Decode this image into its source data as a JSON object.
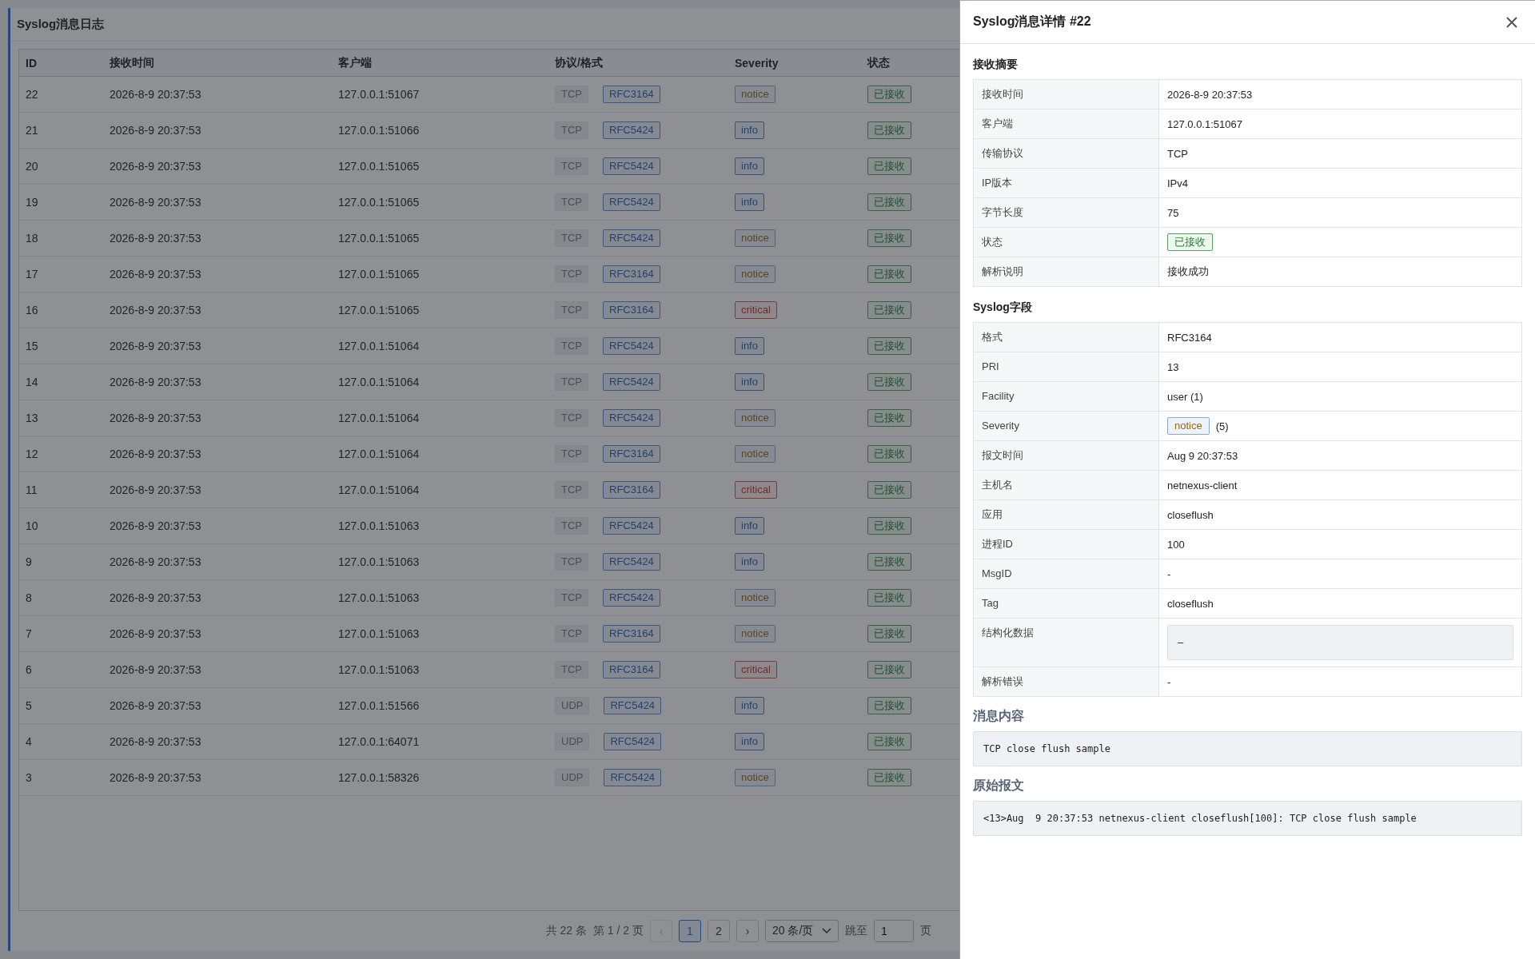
{
  "page": {
    "title": "Syslog消息日志"
  },
  "table": {
    "columns": [
      "ID",
      "接收时间",
      "客户端",
      "协议/格式",
      "Severity",
      "状态"
    ],
    "rows": [
      {
        "id": "22",
        "time": "2026-8-9 20:37:53",
        "client": "127.0.0.1:51067",
        "protocol": "TCP",
        "format": "RFC3164",
        "severity": {
          "label": "notice",
          "kind": "notice"
        },
        "status": "已接收"
      },
      {
        "id": "21",
        "time": "2026-8-9 20:37:53",
        "client": "127.0.0.1:51066",
        "protocol": "TCP",
        "format": "RFC5424",
        "severity": {
          "label": "info",
          "kind": "info"
        },
        "status": "已接收"
      },
      {
        "id": "20",
        "time": "2026-8-9 20:37:53",
        "client": "127.0.0.1:51065",
        "protocol": "TCP",
        "format": "RFC5424",
        "severity": {
          "label": "info",
          "kind": "info"
        },
        "status": "已接收"
      },
      {
        "id": "19",
        "time": "2026-8-9 20:37:53",
        "client": "127.0.0.1:51065",
        "protocol": "TCP",
        "format": "RFC5424",
        "severity": {
          "label": "info",
          "kind": "info"
        },
        "status": "已接收"
      },
      {
        "id": "18",
        "time": "2026-8-9 20:37:53",
        "client": "127.0.0.1:51065",
        "protocol": "TCP",
        "format": "RFC5424",
        "severity": {
          "label": "notice",
          "kind": "notice"
        },
        "status": "已接收"
      },
      {
        "id": "17",
        "time": "2026-8-9 20:37:53",
        "client": "127.0.0.1:51065",
        "protocol": "TCP",
        "format": "RFC3164",
        "severity": {
          "label": "notice",
          "kind": "notice"
        },
        "status": "已接收"
      },
      {
        "id": "16",
        "time": "2026-8-9 20:37:53",
        "client": "127.0.0.1:51065",
        "protocol": "TCP",
        "format": "RFC3164",
        "severity": {
          "label": "critical",
          "kind": "critical"
        },
        "status": "已接收"
      },
      {
        "id": "15",
        "time": "2026-8-9 20:37:53",
        "client": "127.0.0.1:51064",
        "protocol": "TCP",
        "format": "RFC5424",
        "severity": {
          "label": "info",
          "kind": "info"
        },
        "status": "已接收"
      },
      {
        "id": "14",
        "time": "2026-8-9 20:37:53",
        "client": "127.0.0.1:51064",
        "protocol": "TCP",
        "format": "RFC5424",
        "severity": {
          "label": "info",
          "kind": "info"
        },
        "status": "已接收"
      },
      {
        "id": "13",
        "time": "2026-8-9 20:37:53",
        "client": "127.0.0.1:51064",
        "protocol": "TCP",
        "format": "RFC5424",
        "severity": {
          "label": "notice",
          "kind": "notice"
        },
        "status": "已接收"
      },
      {
        "id": "12",
        "time": "2026-8-9 20:37:53",
        "client": "127.0.0.1:51064",
        "protocol": "TCP",
        "format": "RFC3164",
        "severity": {
          "label": "notice",
          "kind": "notice"
        },
        "status": "已接收"
      },
      {
        "id": "11",
        "time": "2026-8-9 20:37:53",
        "client": "127.0.0.1:51064",
        "protocol": "TCP",
        "format": "RFC3164",
        "severity": {
          "label": "critical",
          "kind": "critical"
        },
        "status": "已接收"
      },
      {
        "id": "10",
        "time": "2026-8-9 20:37:53",
        "client": "127.0.0.1:51063",
        "protocol": "TCP",
        "format": "RFC5424",
        "severity": {
          "label": "info",
          "kind": "info"
        },
        "status": "已接收"
      },
      {
        "id": "9",
        "time": "2026-8-9 20:37:53",
        "client": "127.0.0.1:51063",
        "protocol": "TCP",
        "format": "RFC5424",
        "severity": {
          "label": "info",
          "kind": "info"
        },
        "status": "已接收"
      },
      {
        "id": "8",
        "time": "2026-8-9 20:37:53",
        "client": "127.0.0.1:51063",
        "protocol": "TCP",
        "format": "RFC5424",
        "severity": {
          "label": "notice",
          "kind": "notice"
        },
        "status": "已接收"
      },
      {
        "id": "7",
        "time": "2026-8-9 20:37:53",
        "client": "127.0.0.1:51063",
        "protocol": "TCP",
        "format": "RFC3164",
        "severity": {
          "label": "notice",
          "kind": "notice"
        },
        "status": "已接收"
      },
      {
        "id": "6",
        "time": "2026-8-9 20:37:53",
        "client": "127.0.0.1:51063",
        "protocol": "TCP",
        "format": "RFC3164",
        "severity": {
          "label": "critical",
          "kind": "critical"
        },
        "status": "已接收"
      },
      {
        "id": "5",
        "time": "2026-8-9 20:37:53",
        "client": "127.0.0.1:51566",
        "protocol": "UDP",
        "format": "RFC5424",
        "severity": {
          "label": "info",
          "kind": "info"
        },
        "status": "已接收"
      },
      {
        "id": "4",
        "time": "2026-8-9 20:37:53",
        "client": "127.0.0.1:64071",
        "protocol": "UDP",
        "format": "RFC5424",
        "severity": {
          "label": "info",
          "kind": "info"
        },
        "status": "已接收"
      },
      {
        "id": "3",
        "time": "2026-8-9 20:37:53",
        "client": "127.0.0.1:58326",
        "protocol": "UDP",
        "format": "RFC5424",
        "severity": {
          "label": "notice",
          "kind": "notice"
        },
        "status": "已接收"
      }
    ]
  },
  "pagination": {
    "total": "共 22 条",
    "page_info": "第 1 / 2 页",
    "prev": {
      "label": "‹",
      "disabled": true
    },
    "pages": [
      {
        "label": "1",
        "selected": true
      },
      {
        "label": "2",
        "selected": false
      }
    ],
    "next": {
      "label": "›",
      "disabled": false
    },
    "page_size": "20 条/页",
    "jump_label": "跳至",
    "jump_value": "1",
    "jump_suffix": "页"
  },
  "drawer": {
    "title": "Syslog消息详情 #22",
    "sections": [
      {
        "title": "接收摘要",
        "rows": [
          {
            "label": "接收时间",
            "kind": "text",
            "value": "2026-8-9 20:37:53"
          },
          {
            "label": "客户端",
            "kind": "text",
            "value": "127.0.0.1:51067"
          },
          {
            "label": "传输协议",
            "kind": "text",
            "value": "TCP"
          },
          {
            "label": "IP版本",
            "kind": "text",
            "value": "IPv4"
          },
          {
            "label": "字节长度",
            "kind": "text",
            "value": "75"
          },
          {
            "label": "状态",
            "kind": "status",
            "value": "已接收"
          },
          {
            "label": "解析说明",
            "kind": "text",
            "value": "接收成功"
          }
        ]
      },
      {
        "title": "Syslog字段",
        "rows": [
          {
            "label": "格式",
            "kind": "text",
            "value": "RFC3164"
          },
          {
            "label": "PRI",
            "kind": "text",
            "value": "13"
          },
          {
            "label": "Facility",
            "kind": "text",
            "value": "user (1)"
          },
          {
            "label": "Severity",
            "kind": "severity",
            "value": "notice",
            "extra": "(5)"
          },
          {
            "label": "报文时间",
            "kind": "text",
            "value": "Aug 9 20:37:53"
          },
          {
            "label": "主机名",
            "kind": "text",
            "value": "netnexus-client"
          },
          {
            "label": "应用",
            "kind": "text",
            "value": "closeflush"
          },
          {
            "label": "进程ID",
            "kind": "text",
            "value": "100"
          },
          {
            "label": "MsgID",
            "kind": "text",
            "value": "-"
          },
          {
            "label": "Tag",
            "kind": "text",
            "value": "closeflush"
          },
          {
            "label": "结构化数据",
            "kind": "code",
            "value": "–"
          },
          {
            "label": "解析错误",
            "kind": "text",
            "value": "-"
          }
        ]
      }
    ],
    "blocks": [
      {
        "title": "消息内容",
        "content": "TCP close flush sample"
      },
      {
        "title": "原始报文",
        "content": "<13>Aug  9 20:37:53 netnexus-client closeflush[100]: TCP close flush sample"
      }
    ]
  }
}
